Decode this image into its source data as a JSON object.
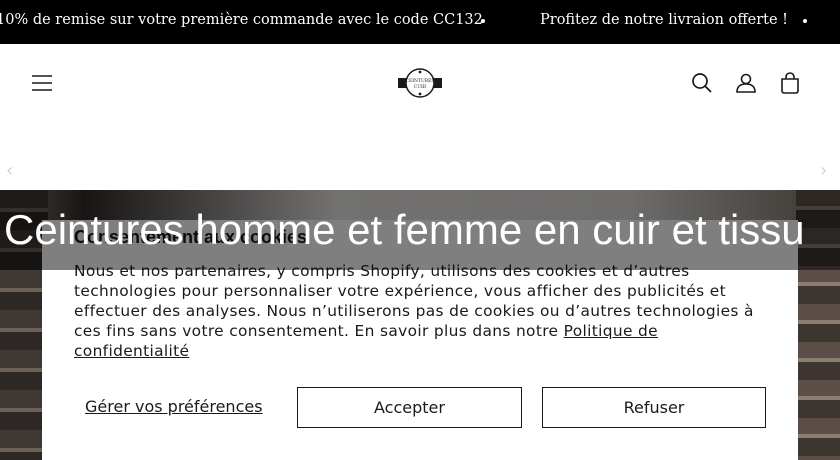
{
  "announcement": {
    "messages": [
      "10% de remise sur votre première commande avec le code CC132",
      "Profitez de notre livraion offerte !"
    ]
  },
  "header": {
    "menu_icon": "hamburger-menu-icon",
    "logo_text": "CEINTURES CUIR",
    "icons": [
      "search-icon",
      "account-icon",
      "cart-icon"
    ]
  },
  "page_title": "Ceintures homme et femme en cuir et tissu",
  "cookie": {
    "title": "Consentement aux cookies",
    "body": "Nous et nos partenaires, y compris Shopify, utilisons des cookies et d’autres technologies pour personnaliser votre expérience, vous afficher des publicités et effectuer des analyses. Nous n’utiliserons pas de cookies ou d’autres technologies à ces fins sans votre consentement. En savoir plus dans notre ",
    "policy_link": "Politique de confidentialité",
    "manage_label": "Gérer vos préférences",
    "accept_label": "Accepter",
    "refuse_label": "Refuser"
  }
}
